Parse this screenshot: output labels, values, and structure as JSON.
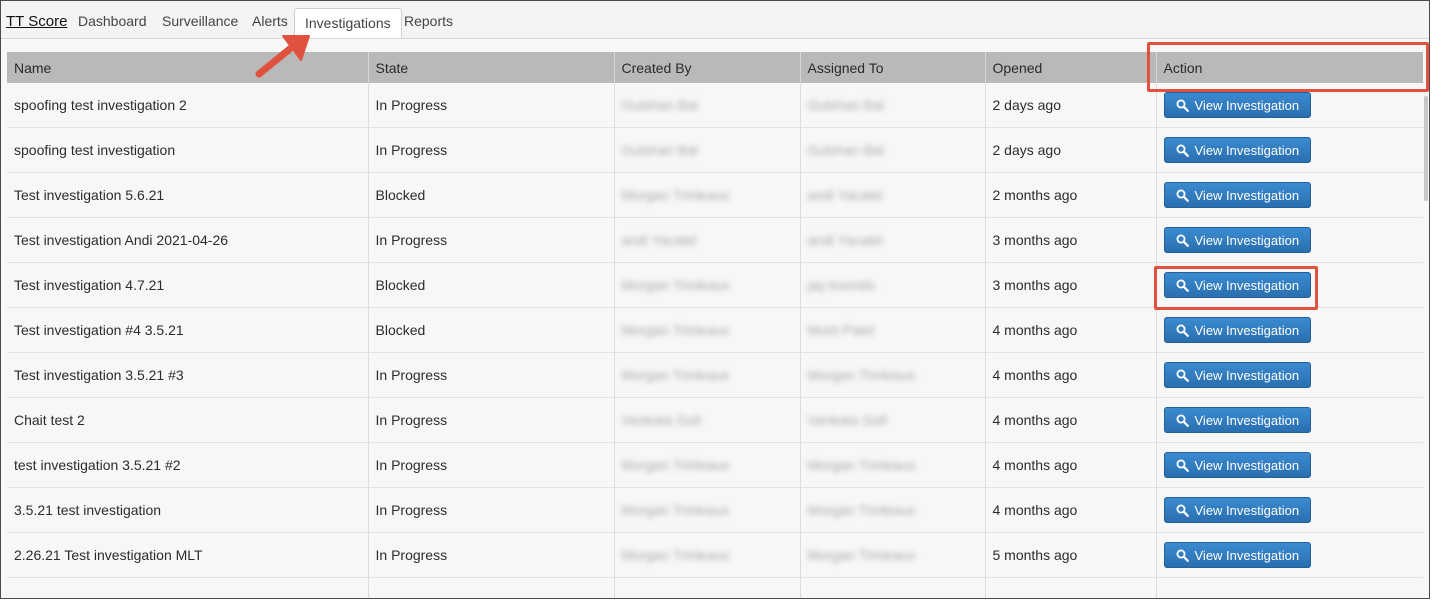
{
  "nav": {
    "brand": "TT Score",
    "tabs": [
      {
        "label": "Dashboard",
        "active": false
      },
      {
        "label": "Surveillance",
        "active": false
      },
      {
        "label": "Alerts",
        "active": false
      },
      {
        "label": "Investigations",
        "active": true
      },
      {
        "label": "Reports",
        "active": false
      }
    ]
  },
  "table": {
    "headers": [
      "Name",
      "State",
      "Created By",
      "Assigned To",
      "Opened",
      "Action"
    ],
    "action_label": "View Investigation",
    "rows": [
      {
        "name": "spoofing test investigation 2",
        "state": "In Progress",
        "created_by": "Gulshan Bal",
        "assigned_to": "Gulshan Bal",
        "opened": "2 days ago"
      },
      {
        "name": "spoofing test investigation",
        "state": "In Progress",
        "created_by": "Gulshan Bal",
        "assigned_to": "Gulshan Bal",
        "opened": "2 days ago"
      },
      {
        "name": "Test investigation 5.6.21",
        "state": "Blocked",
        "created_by": "Morgan Trinleaux",
        "assigned_to": "andi Yacalel",
        "opened": "2 months ago"
      },
      {
        "name": "Test investigation Andi 2021-04-26",
        "state": "In Progress",
        "created_by": "andi Yacalel",
        "assigned_to": "andi Yacalel",
        "opened": "3 months ago"
      },
      {
        "name": "Test investigation 4.7.21",
        "state": "Blocked",
        "created_by": "Morgan Trinleaux",
        "assigned_to": "jay koondo",
        "opened": "3 months ago"
      },
      {
        "name": "Test investigation #4 3.5.21",
        "state": "Blocked",
        "created_by": "Morgan Trinleaux",
        "assigned_to": "Mont Patel",
        "opened": "4 months ago"
      },
      {
        "name": "Test investigation 3.5.21 #3",
        "state": "In Progress",
        "created_by": "Morgan Trinleaux",
        "assigned_to": "Morgan Trinleaux",
        "opened": "4 months ago"
      },
      {
        "name": "Chait test 2",
        "state": "In Progress",
        "created_by": "Venkata Goll",
        "assigned_to": "Venkata Goll",
        "opened": "4 months ago"
      },
      {
        "name": "test investigation 3.5.21 #2",
        "state": "In Progress",
        "created_by": "Morgan Trinleaux",
        "assigned_to": "Morgan Trinleaux",
        "opened": "4 months ago"
      },
      {
        "name": "3.5.21 test investigation",
        "state": "In Progress",
        "created_by": "Morgan Trinleaux",
        "assigned_to": "Morgan Trinleaux",
        "opened": "4 months ago"
      },
      {
        "name": "2.26.21 Test investigation MLT",
        "state": "In Progress",
        "created_by": "Morgan Trinleaux",
        "assigned_to": "Morgan Trinleaux",
        "opened": "5 months ago"
      },
      {
        "name": "",
        "state": "",
        "created_by": "",
        "assigned_to": "",
        "opened": ""
      }
    ]
  },
  "icons": {
    "view_button_icon": "search-icon",
    "annotation_arrow": "arrow-icon"
  },
  "colors": {
    "button": "#2f7bc0",
    "annotation": "#e0523f",
    "header_bg": "#b9b9b9"
  }
}
